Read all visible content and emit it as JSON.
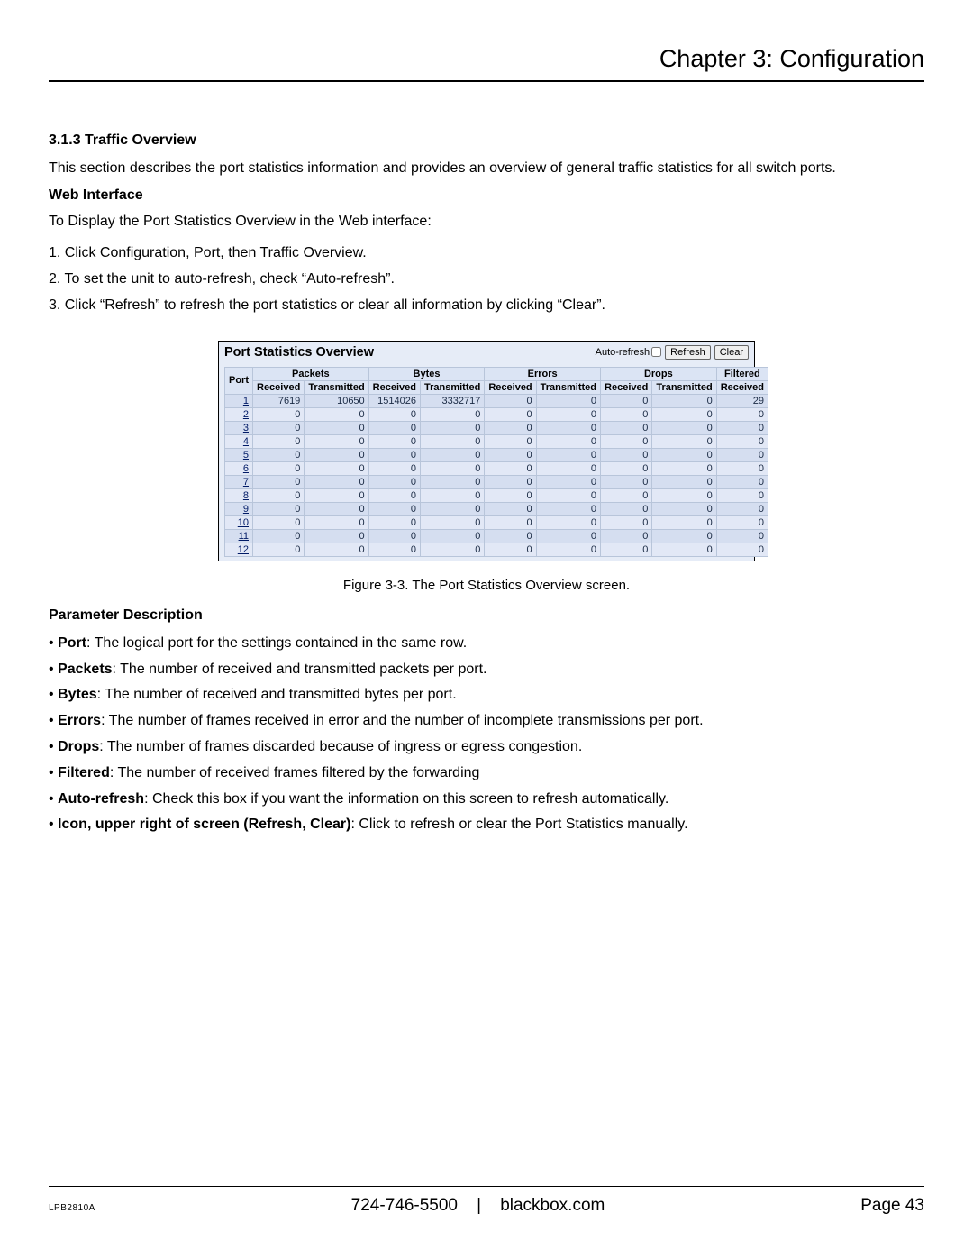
{
  "chapter_title": "Chapter 3: Configuration",
  "section_number": "3.1.3 Traffic Overview",
  "section_intro": "This section describes the port statistics information and provides an overview of general traffic statistics for all switch ports.",
  "web_interface_heading": "Web Interface",
  "web_interface_intro": "To Display the Port Statistics Overview in the Web interface:",
  "steps": [
    "1. Click Configuration, Port, then Traffic Overview.",
    "2. To set the unit to auto-refresh, check “Auto-refresh”.",
    "3. Click “Refresh” to refresh the port statistics or clear all information by clicking “Clear”."
  ],
  "screenshot": {
    "title": "Port Statistics Overview",
    "auto_refresh_label": "Auto-refresh",
    "refresh_btn": "Refresh",
    "clear_btn": "Clear",
    "headers_top": [
      "Port",
      "Packets",
      "Bytes",
      "Errors",
      "Drops",
      "Filtered"
    ],
    "headers_sub": [
      "Received",
      "Transmitted",
      "Received",
      "Transmitted",
      "Received",
      "Transmitted",
      "Received",
      "Transmitted",
      "Received"
    ],
    "rows": [
      {
        "port": "1",
        "pr": "7619",
        "pt": "10650",
        "br": "1514026",
        "bt": "3332717",
        "er": "0",
        "et": "0",
        "dr": "0",
        "dt": "0",
        "fr": "29"
      },
      {
        "port": "2",
        "pr": "0",
        "pt": "0",
        "br": "0",
        "bt": "0",
        "er": "0",
        "et": "0",
        "dr": "0",
        "dt": "0",
        "fr": "0"
      },
      {
        "port": "3",
        "pr": "0",
        "pt": "0",
        "br": "0",
        "bt": "0",
        "er": "0",
        "et": "0",
        "dr": "0",
        "dt": "0",
        "fr": "0"
      },
      {
        "port": "4",
        "pr": "0",
        "pt": "0",
        "br": "0",
        "bt": "0",
        "er": "0",
        "et": "0",
        "dr": "0",
        "dt": "0",
        "fr": "0"
      },
      {
        "port": "5",
        "pr": "0",
        "pt": "0",
        "br": "0",
        "bt": "0",
        "er": "0",
        "et": "0",
        "dr": "0",
        "dt": "0",
        "fr": "0"
      },
      {
        "port": "6",
        "pr": "0",
        "pt": "0",
        "br": "0",
        "bt": "0",
        "er": "0",
        "et": "0",
        "dr": "0",
        "dt": "0",
        "fr": "0"
      },
      {
        "port": "7",
        "pr": "0",
        "pt": "0",
        "br": "0",
        "bt": "0",
        "er": "0",
        "et": "0",
        "dr": "0",
        "dt": "0",
        "fr": "0"
      },
      {
        "port": "8",
        "pr": "0",
        "pt": "0",
        "br": "0",
        "bt": "0",
        "er": "0",
        "et": "0",
        "dr": "0",
        "dt": "0",
        "fr": "0"
      },
      {
        "port": "9",
        "pr": "0",
        "pt": "0",
        "br": "0",
        "bt": "0",
        "er": "0",
        "et": "0",
        "dr": "0",
        "dt": "0",
        "fr": "0"
      },
      {
        "port": "10",
        "pr": "0",
        "pt": "0",
        "br": "0",
        "bt": "0",
        "er": "0",
        "et": "0",
        "dr": "0",
        "dt": "0",
        "fr": "0"
      },
      {
        "port": "11",
        "pr": "0",
        "pt": "0",
        "br": "0",
        "bt": "0",
        "er": "0",
        "et": "0",
        "dr": "0",
        "dt": "0",
        "fr": "0"
      },
      {
        "port": "12",
        "pr": "0",
        "pt": "0",
        "br": "0",
        "bt": "0",
        "er": "0",
        "et": "0",
        "dr": "0",
        "dt": "0",
        "fr": "0"
      }
    ]
  },
  "figure_caption": "Figure 3-3. The Port Statistics Overview screen.",
  "param_heading": "Parameter Description",
  "params": [
    {
      "name": "Port",
      "desc": ": The logical port for the settings contained in the same row."
    },
    {
      "name": "Packets",
      "desc": ": The number of received and transmitted packets per port."
    },
    {
      "name": "Bytes",
      "desc": ": The number of received and transmitted bytes per port."
    },
    {
      "name": "Errors",
      "desc": ": The number of frames received in error and the number of incomplete transmissions per port."
    },
    {
      "name": "Drops",
      "desc": ": The number of frames discarded because of ingress or egress congestion."
    },
    {
      "name": "Filtered",
      "desc": ": The number of received frames filtered by the forwarding"
    },
    {
      "name": "Auto-refresh",
      "desc": ": Check this box if you want the information on this screen to refresh automatically."
    },
    {
      "name": "Icon, upper right of screen (Refresh, Clear)",
      "desc": ": Click to refresh or clear the Port Statistics manually."
    }
  ],
  "footer": {
    "model": "LPB2810A",
    "phone": "724-746-5500",
    "sep": "|",
    "site": "blackbox.com",
    "page": "Page 43"
  }
}
